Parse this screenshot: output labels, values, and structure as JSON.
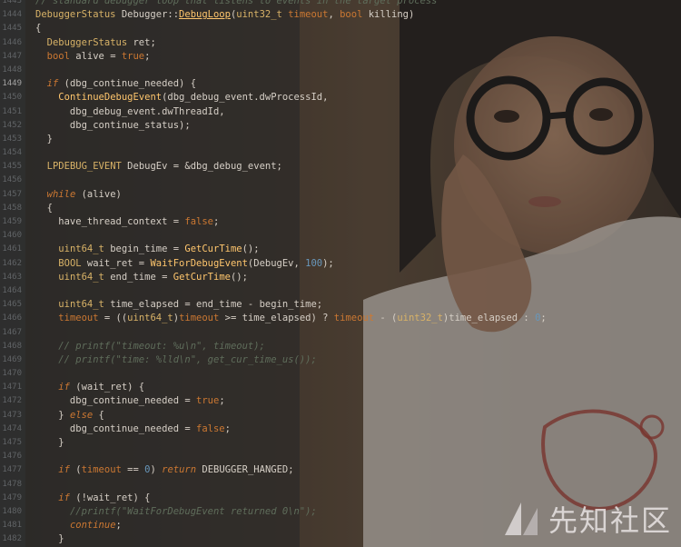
{
  "lines": [
    {
      "n": "1443",
      "cur": false,
      "t": [
        [
          "cm",
          "// standard debugger loop that listens to events in the target process"
        ]
      ]
    },
    {
      "n": "1444",
      "cur": false,
      "t": [
        [
          "ty",
          "DebuggerStatus "
        ],
        [
          "pl",
          "Debugger::"
        ],
        [
          "uf",
          "DebugLoop"
        ],
        [
          "pl",
          "("
        ],
        [
          "ty",
          "uint32_t "
        ],
        [
          "kw",
          "timeout"
        ],
        [
          "pl",
          ", "
        ],
        [
          "kw",
          "bool "
        ],
        [
          "pl",
          "killing)"
        ]
      ]
    },
    {
      "n": "1445",
      "cur": false,
      "t": [
        [
          "pl",
          "{"
        ]
      ]
    },
    {
      "n": "1446",
      "cur": false,
      "t": [
        [
          "pl",
          "  "
        ],
        [
          "ty",
          "DebuggerStatus "
        ],
        [
          "pl",
          "ret;"
        ]
      ]
    },
    {
      "n": "1447",
      "cur": false,
      "t": [
        [
          "pl",
          "  "
        ],
        [
          "kw",
          "bool "
        ],
        [
          "pl",
          "alive = "
        ],
        [
          "kw",
          "true"
        ],
        [
          "pl",
          ";"
        ]
      ]
    },
    {
      "n": "1448",
      "cur": false,
      "t": []
    },
    {
      "n": "1449",
      "cur": true,
      "t": [
        [
          "pl",
          "  "
        ],
        [
          "kw",
          "if "
        ],
        [
          "pl",
          "(dbg_continue_needed) {"
        ]
      ]
    },
    {
      "n": "1450",
      "cur": false,
      "t": [
        [
          "pl",
          "    "
        ],
        [
          "fn",
          "ContinueDebugEvent"
        ],
        [
          "pl",
          "(dbg_debug_event.dwProcessId,"
        ]
      ]
    },
    {
      "n": "1451",
      "cur": false,
      "t": [
        [
          "pl",
          "      dbg_debug_event.dwThreadId,"
        ]
      ]
    },
    {
      "n": "1452",
      "cur": false,
      "t": [
        [
          "pl",
          "      dbg_continue_status);"
        ]
      ]
    },
    {
      "n": "1453",
      "cur": false,
      "t": [
        [
          "pl",
          "  }"
        ]
      ]
    },
    {
      "n": "1454",
      "cur": false,
      "t": []
    },
    {
      "n": "1455",
      "cur": false,
      "t": [
        [
          "pl",
          "  "
        ],
        [
          "ty",
          "LPDEBUG_EVENT "
        ],
        [
          "pl",
          "DebugEv = &dbg_debug_event;"
        ]
      ]
    },
    {
      "n": "1456",
      "cur": false,
      "t": []
    },
    {
      "n": "1457",
      "cur": false,
      "t": [
        [
          "pl",
          "  "
        ],
        [
          "kw",
          "while "
        ],
        [
          "pl",
          "(alive)"
        ]
      ]
    },
    {
      "n": "1458",
      "cur": false,
      "t": [
        [
          "pl",
          "  {"
        ]
      ]
    },
    {
      "n": "1459",
      "cur": false,
      "t": [
        [
          "pl",
          "    have_thread_context = "
        ],
        [
          "kw",
          "false"
        ],
        [
          "pl",
          ";"
        ]
      ]
    },
    {
      "n": "1460",
      "cur": false,
      "t": []
    },
    {
      "n": "1461",
      "cur": false,
      "t": [
        [
          "pl",
          "    "
        ],
        [
          "ty",
          "uint64_t "
        ],
        [
          "pl",
          "begin_time = "
        ],
        [
          "fn",
          "GetCurTime"
        ],
        [
          "pl",
          "();"
        ]
      ]
    },
    {
      "n": "1462",
      "cur": false,
      "t": [
        [
          "pl",
          "    "
        ],
        [
          "ty",
          "BOOL "
        ],
        [
          "pl",
          "wait_ret = "
        ],
        [
          "fn",
          "WaitForDebugEvent"
        ],
        [
          "pl",
          "(DebugEv, "
        ],
        [
          "num",
          "100"
        ],
        [
          "pl",
          ");"
        ]
      ]
    },
    {
      "n": "1463",
      "cur": false,
      "t": [
        [
          "pl",
          "    "
        ],
        [
          "ty",
          "uint64_t "
        ],
        [
          "pl",
          "end_time = "
        ],
        [
          "fn",
          "GetCurTime"
        ],
        [
          "pl",
          "();"
        ]
      ]
    },
    {
      "n": "1464",
      "cur": false,
      "t": []
    },
    {
      "n": "1465",
      "cur": false,
      "t": [
        [
          "pl",
          "    "
        ],
        [
          "ty",
          "uint64_t "
        ],
        [
          "pl",
          "time_elapsed = end_time - begin_time;"
        ]
      ]
    },
    {
      "n": "1466",
      "cur": false,
      "t": [
        [
          "pl",
          "    "
        ],
        [
          "kw",
          "timeout"
        ],
        [
          "pl",
          " = (("
        ],
        [
          "ty",
          "uint64_t"
        ],
        [
          "pl",
          ")"
        ],
        [
          "kw",
          "timeout"
        ],
        [
          "pl",
          " >= time_elapsed) ? "
        ],
        [
          "kw",
          "timeout"
        ],
        [
          "pl",
          " - ("
        ],
        [
          "ty",
          "uint32_t"
        ],
        [
          "pl",
          ")time_elapsed : "
        ],
        [
          "num",
          "0"
        ],
        [
          "pl",
          ";"
        ]
      ]
    },
    {
      "n": "1467",
      "cur": false,
      "t": []
    },
    {
      "n": "1468",
      "cur": false,
      "t": [
        [
          "pl",
          "    "
        ],
        [
          "cm",
          "// printf(\"timeout: %u\\n\", timeout);"
        ]
      ]
    },
    {
      "n": "1469",
      "cur": false,
      "t": [
        [
          "pl",
          "    "
        ],
        [
          "cm",
          "// printf(\"time: %lld\\n\", get_cur_time_us());"
        ]
      ]
    },
    {
      "n": "1470",
      "cur": false,
      "t": []
    },
    {
      "n": "1471",
      "cur": false,
      "t": [
        [
          "pl",
          "    "
        ],
        [
          "kw",
          "if "
        ],
        [
          "pl",
          "(wait_ret) {"
        ]
      ]
    },
    {
      "n": "1472",
      "cur": false,
      "t": [
        [
          "pl",
          "      dbg_continue_needed = "
        ],
        [
          "kw",
          "true"
        ],
        [
          "pl",
          ";"
        ]
      ]
    },
    {
      "n": "1473",
      "cur": false,
      "t": [
        [
          "pl",
          "    } "
        ],
        [
          "kw",
          "else "
        ],
        [
          "pl",
          "{"
        ]
      ]
    },
    {
      "n": "1474",
      "cur": false,
      "t": [
        [
          "pl",
          "      dbg_continue_needed = "
        ],
        [
          "kw",
          "false"
        ],
        [
          "pl",
          ";"
        ]
      ]
    },
    {
      "n": "1475",
      "cur": false,
      "t": [
        [
          "pl",
          "    }"
        ]
      ]
    },
    {
      "n": "1476",
      "cur": false,
      "t": []
    },
    {
      "n": "1477",
      "cur": false,
      "t": [
        [
          "pl",
          "    "
        ],
        [
          "kw",
          "if "
        ],
        [
          "pl",
          "("
        ],
        [
          "kw",
          "timeout"
        ],
        [
          "pl",
          " == "
        ],
        [
          "num",
          "0"
        ],
        [
          "pl",
          ") "
        ],
        [
          "kw",
          "return "
        ],
        [
          "pl",
          "DEBUGGER_HANGED;"
        ]
      ]
    },
    {
      "n": "1478",
      "cur": false,
      "t": []
    },
    {
      "n": "1479",
      "cur": false,
      "t": [
        [
          "pl",
          "    "
        ],
        [
          "kw",
          "if "
        ],
        [
          "pl",
          "(!wait_ret) {"
        ]
      ]
    },
    {
      "n": "1480",
      "cur": false,
      "t": [
        [
          "pl",
          "      "
        ],
        [
          "cm",
          "//printf(\"WaitForDebugEvent returned 0\\n\");"
        ]
      ]
    },
    {
      "n": "1481",
      "cur": false,
      "t": [
        [
          "pl",
          "      "
        ],
        [
          "kw",
          "continue"
        ],
        [
          "pl",
          ";"
        ]
      ]
    },
    {
      "n": "1482",
      "cur": false,
      "t": [
        [
          "pl",
          "    }"
        ]
      ]
    }
  ],
  "watermark": {
    "text": "先知社区"
  }
}
